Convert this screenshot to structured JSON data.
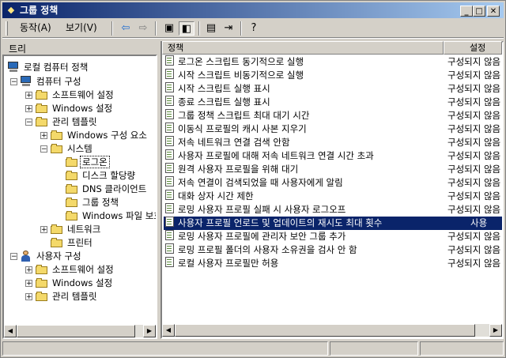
{
  "window": {
    "title": "그룹 정책"
  },
  "menu": {
    "action": "동작(A)",
    "view": "보기(V)"
  },
  "tree": {
    "header": "트리",
    "items": [
      {
        "label": "로컬 컴퓨터 정책"
      },
      {
        "label": "컴퓨터 구성"
      },
      {
        "label": "소프트웨어 설정"
      },
      {
        "label": "Windows 설정"
      },
      {
        "label": "관리 템플릿"
      },
      {
        "label": "Windows 구성 요소"
      },
      {
        "label": "시스템"
      },
      {
        "label": "로그온"
      },
      {
        "label": "디스크 할당량"
      },
      {
        "label": "DNS 클라이언트"
      },
      {
        "label": "그룹 정책"
      },
      {
        "label": "Windows 파일 보호"
      },
      {
        "label": "네트워크"
      },
      {
        "label": "프린터"
      },
      {
        "label": "사용자 구성"
      },
      {
        "label": "소프트웨어 설정"
      },
      {
        "label": "Windows 설정"
      },
      {
        "label": "관리 템플릿"
      }
    ]
  },
  "list": {
    "col_policy": "정책",
    "col_setting": "설정",
    "rows": [
      {
        "name": "로그온 스크립트 동기적으로 실행",
        "value": "구성되지 않음"
      },
      {
        "name": "시작 스크립트 비동기적으로 실행",
        "value": "구성되지 않음"
      },
      {
        "name": "시작 스크립트 실행 표시",
        "value": "구성되지 않음"
      },
      {
        "name": "종료 스크립트 실행 표시",
        "value": "구성되지 않음"
      },
      {
        "name": "그룹 정책 스크립트 최대 대기 시간",
        "value": "구성되지 않음"
      },
      {
        "name": "이동식 프로필의 캐시 사본 지우기",
        "value": "구성되지 않음"
      },
      {
        "name": "저속 네트워크 연결 검색 안함",
        "value": "구성되지 않음"
      },
      {
        "name": "사용자 프로필에 대해 저속 네트워크 연결 시간 초과",
        "value": "구성되지 않음"
      },
      {
        "name": "원격 사용자 프로필을 위해 대기",
        "value": "구성되지 않음"
      },
      {
        "name": "저속 연결이 검색되었을 때 사용자에게 알림",
        "value": "구성되지 않음"
      },
      {
        "name": "대화 상자 시간 제한",
        "value": "구성되지 않음"
      },
      {
        "name": "로밍 사용자 프로필 실패 시 사용자 로그오프",
        "value": "구성되지 않음"
      },
      {
        "name": "사용자 프로필 언로드 및 업데이트의 재시도 최대 횟수",
        "value": "사용"
      },
      {
        "name": "로밍 사용자 프로필에 관리자 보안 그룹 추가",
        "value": "구성되지 않음"
      },
      {
        "name": "로밍 프로필 폴더의 사용자 소유권을 검사 안 함",
        "value": "구성되지 않음"
      },
      {
        "name": "로컬 사용자 프로필만 허용",
        "value": "구성되지 않음"
      }
    ]
  }
}
